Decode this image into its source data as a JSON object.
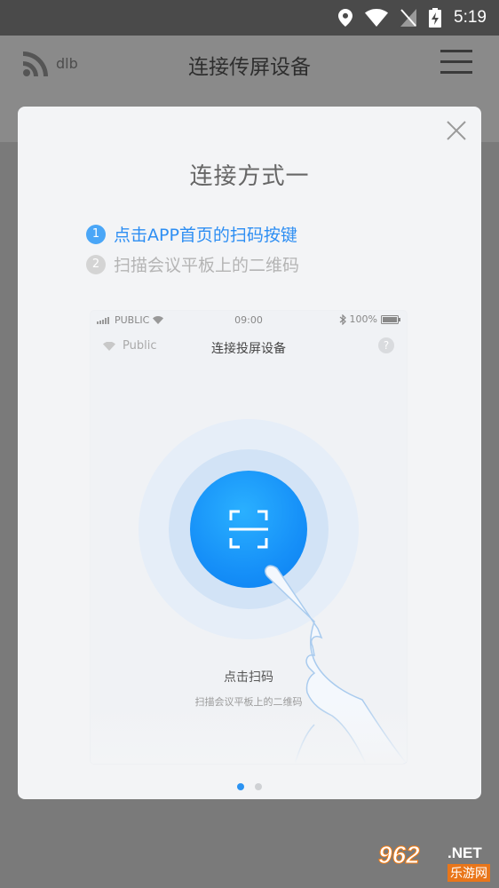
{
  "status_bar": {
    "time": "5:19"
  },
  "header": {
    "wifi_name": "dlb",
    "title": "连接传屏设备"
  },
  "modal": {
    "title": "连接方式一",
    "steps": [
      {
        "num": "1",
        "text": "点击APP首页的扫码按键"
      },
      {
        "num": "2",
        "text": "扫描会议平板上的二维码"
      }
    ],
    "phone": {
      "carrier": "PUBLIC",
      "time": "09:00",
      "battery": "100%",
      "wifi_name": "Public",
      "title": "连接投屏设备",
      "help": "?",
      "scan_label": "点击扫码",
      "scan_hint": "扫描会议平板上的二维码"
    },
    "pager": {
      "total": 2,
      "active": 0
    }
  },
  "watermark": {
    "number": "962",
    "net": ".NET",
    "cn": "乐游网"
  },
  "colors": {
    "accent": "#2b93f2",
    "scan_button": "#1690f8"
  }
}
